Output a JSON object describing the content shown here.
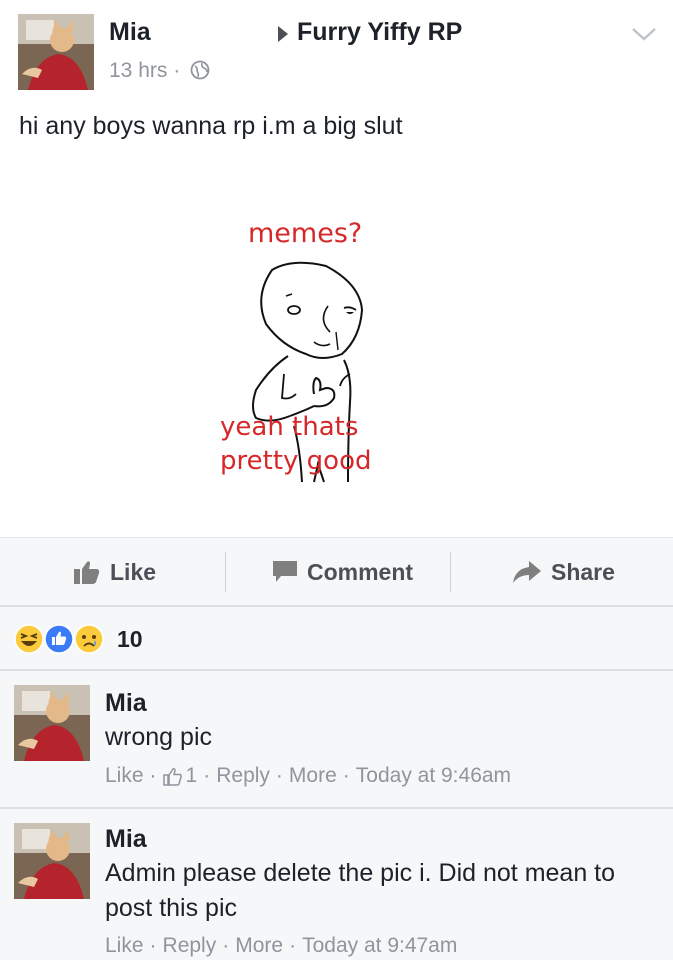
{
  "post": {
    "author": "Mia",
    "group": "Furry Yiffy RP",
    "time": "13 hrs ·",
    "text": "hi any boys wanna rp i.m a big slut",
    "meme": {
      "top_text": "memes?",
      "bottom_text": "yeah thats pretty good"
    }
  },
  "actions": {
    "like": "Like",
    "comment": "Comment",
    "share": "Share"
  },
  "reactions": {
    "icons": [
      "haha-icon",
      "like-icon",
      "sad-icon"
    ],
    "count": "10"
  },
  "comments": [
    {
      "author": "Mia",
      "text": "wrong pic",
      "like": "Like",
      "like_count": "1",
      "reply": "Reply",
      "more": "More",
      "time": "Today at 9:46am"
    },
    {
      "author": "Mia",
      "text": "Admin please delete the pic i. Did not mean to post this pic",
      "like": "Like",
      "reply": "Reply",
      "more": "More",
      "time": "Today at 9:47am"
    }
  ],
  "colors": {
    "meme_text": "#d6282a",
    "meta_gray": "#90949c",
    "bar_bg": "#f6f7f9",
    "like_blue": "#3b7bf6",
    "reaction_yellow": "#fccb3c"
  }
}
